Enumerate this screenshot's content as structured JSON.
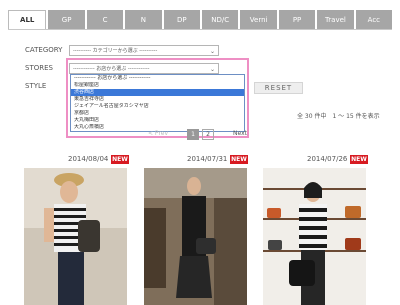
{
  "tabs": [
    "ALL",
    "GP",
    "C",
    "N",
    "DP",
    "ND/C",
    "Verni",
    "PP",
    "Travel",
    "Acc"
  ],
  "filters": {
    "category_label": "CATEGORY",
    "category_value": "---------- カテゴリーから選ぶ ----------",
    "stores_label": "STORES",
    "stores_value": "------------ お店から選ぶ ------------",
    "style_label": "STYLE"
  },
  "stores_options": [
    "------------ お店から選ぶ ------------",
    "松屋銀座店",
    "渋谷西店",
    "東急吉祥寺店",
    "ジェイアール名古屋タカシマヤ店",
    "京都店",
    "大丸梅田店",
    "大丸心斎橋店"
  ],
  "stores_selected_index": 2,
  "reset_label": "RESET",
  "result_count": "全 30 件中　1 〜 15 件を表示",
  "pagination": {
    "prev": "< Prev",
    "pages": [
      "1",
      "2"
    ],
    "next": "Next"
  },
  "items": [
    {
      "date": "2014/08/04",
      "badge": "NEW"
    },
    {
      "date": "2014/07/31",
      "badge": "NEW"
    },
    {
      "date": "2014/07/26",
      "badge": "NEW"
    }
  ],
  "colors": {
    "tab_gray": "#a6a6a6",
    "highlight": "#ee8fc4",
    "new_badge": "#d71a21",
    "option_selected": "#3b78d8"
  }
}
